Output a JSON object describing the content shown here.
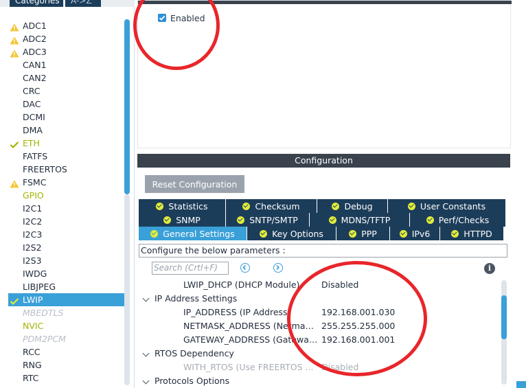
{
  "left_tabs": {
    "categories": "Categories",
    "az": "A->Z"
  },
  "left_list": [
    {
      "label": "ADC1",
      "status": "warning",
      "style": "normal"
    },
    {
      "label": "ADC2",
      "status": "warning",
      "style": "normal"
    },
    {
      "label": "ADC3",
      "status": "warning",
      "style": "normal"
    },
    {
      "label": "CAN1",
      "status": "none",
      "style": "normal"
    },
    {
      "label": "CAN2",
      "status": "none",
      "style": "normal"
    },
    {
      "label": "CRC",
      "status": "none",
      "style": "normal"
    },
    {
      "label": "DAC",
      "status": "none",
      "style": "normal"
    },
    {
      "label": "DCMI",
      "status": "none",
      "style": "normal"
    },
    {
      "label": "DMA",
      "status": "none",
      "style": "normal"
    },
    {
      "label": "ETH",
      "status": "check",
      "style": "green"
    },
    {
      "label": "FATFS",
      "status": "none",
      "style": "normal"
    },
    {
      "label": "FREERTOS",
      "status": "none",
      "style": "normal"
    },
    {
      "label": "FSMC",
      "status": "warning",
      "style": "normal"
    },
    {
      "label": "GPIO",
      "status": "none",
      "style": "green"
    },
    {
      "label": "I2C1",
      "status": "none",
      "style": "normal"
    },
    {
      "label": "I2C2",
      "status": "none",
      "style": "normal"
    },
    {
      "label": "I2C3",
      "status": "none",
      "style": "normal"
    },
    {
      "label": "I2S2",
      "status": "none",
      "style": "normal"
    },
    {
      "label": "I2S3",
      "status": "none",
      "style": "normal"
    },
    {
      "label": "IWDG",
      "status": "none",
      "style": "normal"
    },
    {
      "label": "LIBJPEG",
      "status": "none",
      "style": "normal"
    },
    {
      "label": "LWIP",
      "status": "check",
      "style": "selected"
    },
    {
      "label": "MBEDTLS",
      "status": "none",
      "style": "italic"
    },
    {
      "label": "NVIC",
      "status": "none",
      "style": "green"
    },
    {
      "label": "PDM2PCM",
      "status": "none",
      "style": "italic"
    },
    {
      "label": "RCC",
      "status": "none",
      "style": "normal"
    },
    {
      "label": "RNG",
      "status": "none",
      "style": "normal"
    },
    {
      "label": "RTC",
      "status": "none",
      "style": "normal"
    }
  ],
  "mode": {
    "enabled_label": "Enabled",
    "enabled_checked": true
  },
  "config": {
    "title": "Configuration",
    "reset_label": "Reset Configuration",
    "tab_rows": [
      [
        "Statistics",
        "Checksum",
        "Debug",
        "User Constants"
      ],
      [
        "SNMP",
        "SNTP/SMTP",
        "MDNS/TFTP",
        "Perf/Checks"
      ],
      [
        "General Settings",
        "Key Options",
        "PPP",
        "IPv6",
        "HTTPD"
      ]
    ],
    "active_tab": "General Settings",
    "instructions": "Configure the below parameters :",
    "search_placeholder": "Search (Crtl+F)"
  },
  "params": [
    {
      "type": "param",
      "name": "LWIP_DHCP (DHCP Module)",
      "value": "Disabled",
      "enabled": true
    },
    {
      "type": "group",
      "name": "IP Address Settings"
    },
    {
      "type": "param",
      "name": "IP_ADDRESS (IP Address)",
      "value": "192.168.001.030",
      "enabled": true
    },
    {
      "type": "param",
      "name": "NETMASK_ADDRESS (Netmask Address)",
      "value": "255.255.255.000",
      "enabled": true
    },
    {
      "type": "param",
      "name": "GATEWAY_ADDRESS (Gateway Address)",
      "value": "192.168.001.001",
      "enabled": true
    },
    {
      "type": "group",
      "name": "RTOS Dependency"
    },
    {
      "type": "param",
      "name": "WITH_RTOS (Use FREERTOS ...",
      "value": "Disabled",
      "enabled": false
    },
    {
      "type": "group",
      "name": "Protocols Options"
    }
  ],
  "colors": {
    "accent": "#3aa0d8",
    "navy": "#1c3d5a",
    "warning": "#f4c430",
    "check": "#a3b300",
    "annotation": "#e8262b"
  }
}
